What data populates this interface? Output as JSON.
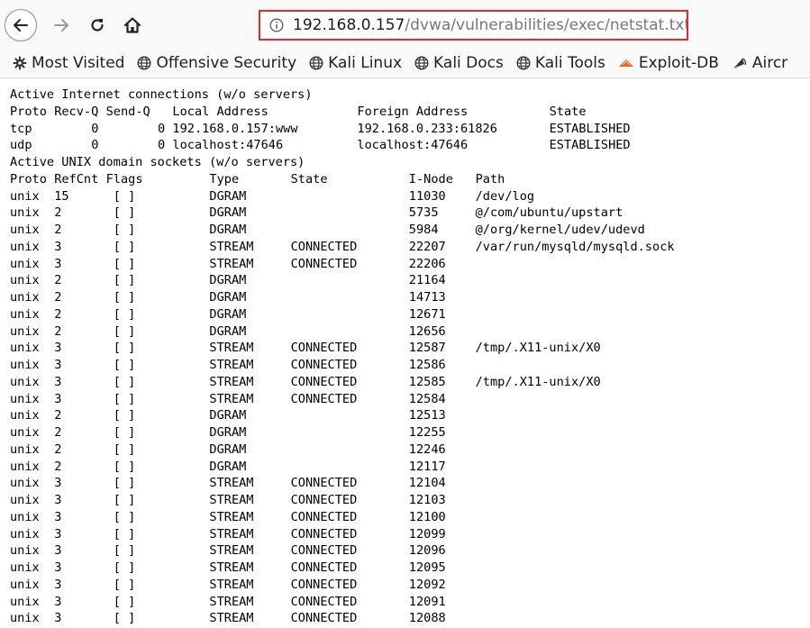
{
  "browser": {
    "url_host": "192.168.0.157",
    "url_path": "/dvwa/vulnerabilities/exec/netstat.txt",
    "icons": {
      "back": "back-arrow-icon",
      "forward": "forward-arrow-icon",
      "reload": "reload-icon",
      "home": "home-icon",
      "info": "info-icon"
    }
  },
  "bookmarks": [
    {
      "label": "Most Visited",
      "icon": "gear-icon"
    },
    {
      "label": "Offensive Security",
      "icon": "globe-icon"
    },
    {
      "label": "Kali Linux",
      "icon": "globe-icon"
    },
    {
      "label": "Kali Docs",
      "icon": "globe-icon"
    },
    {
      "label": "Kali Tools",
      "icon": "globe-icon"
    },
    {
      "label": "Exploit-DB",
      "icon": "exploit-db-icon"
    },
    {
      "label": "Aircr",
      "icon": "aircrack-icon"
    }
  ],
  "netstat": {
    "inet_heading": "Active Internet connections (w/o servers)",
    "inet_columns": [
      "Proto",
      "Recv-Q",
      "Send-Q",
      "Local Address",
      "Foreign Address",
      "State"
    ],
    "inet_rows": [
      [
        "tcp",
        "0",
        "0",
        "192.168.0.157:www",
        "192.168.0.233:61826",
        "ESTABLISHED"
      ],
      [
        "udp",
        "0",
        "0",
        "localhost:47646",
        "localhost:47646",
        "ESTABLISHED"
      ]
    ],
    "unix_heading": "Active UNIX domain sockets (w/o servers)",
    "unix_columns": [
      "Proto",
      "RefCnt",
      "Flags",
      "Type",
      "State",
      "I-Node",
      "Path"
    ],
    "unix_rows": [
      [
        "unix",
        "15",
        "[ ]",
        "DGRAM",
        "",
        "11030",
        "/dev/log"
      ],
      [
        "unix",
        "2",
        "[ ]",
        "DGRAM",
        "",
        "5735",
        "@/com/ubuntu/upstart"
      ],
      [
        "unix",
        "2",
        "[ ]",
        "DGRAM",
        "",
        "5984",
        "@/org/kernel/udev/udevd"
      ],
      [
        "unix",
        "3",
        "[ ]",
        "STREAM",
        "CONNECTED",
        "22207",
        "/var/run/mysqld/mysqld.sock"
      ],
      [
        "unix",
        "3",
        "[ ]",
        "STREAM",
        "CONNECTED",
        "22206",
        ""
      ],
      [
        "unix",
        "2",
        "[ ]",
        "DGRAM",
        "",
        "21164",
        ""
      ],
      [
        "unix",
        "2",
        "[ ]",
        "DGRAM",
        "",
        "14713",
        ""
      ],
      [
        "unix",
        "2",
        "[ ]",
        "DGRAM",
        "",
        "12671",
        ""
      ],
      [
        "unix",
        "2",
        "[ ]",
        "DGRAM",
        "",
        "12656",
        ""
      ],
      [
        "unix",
        "3",
        "[ ]",
        "STREAM",
        "CONNECTED",
        "12587",
        "/tmp/.X11-unix/X0"
      ],
      [
        "unix",
        "3",
        "[ ]",
        "STREAM",
        "CONNECTED",
        "12586",
        ""
      ],
      [
        "unix",
        "3",
        "[ ]",
        "STREAM",
        "CONNECTED",
        "12585",
        "/tmp/.X11-unix/X0"
      ],
      [
        "unix",
        "3",
        "[ ]",
        "STREAM",
        "CONNECTED",
        "12584",
        ""
      ],
      [
        "unix",
        "2",
        "[ ]",
        "DGRAM",
        "",
        "12513",
        ""
      ],
      [
        "unix",
        "2",
        "[ ]",
        "DGRAM",
        "",
        "12255",
        ""
      ],
      [
        "unix",
        "2",
        "[ ]",
        "DGRAM",
        "",
        "12246",
        ""
      ],
      [
        "unix",
        "2",
        "[ ]",
        "DGRAM",
        "",
        "12117",
        ""
      ],
      [
        "unix",
        "3",
        "[ ]",
        "STREAM",
        "CONNECTED",
        "12104",
        ""
      ],
      [
        "unix",
        "3",
        "[ ]",
        "STREAM",
        "CONNECTED",
        "12103",
        ""
      ],
      [
        "unix",
        "3",
        "[ ]",
        "STREAM",
        "CONNECTED",
        "12100",
        ""
      ],
      [
        "unix",
        "3",
        "[ ]",
        "STREAM",
        "CONNECTED",
        "12099",
        ""
      ],
      [
        "unix",
        "3",
        "[ ]",
        "STREAM",
        "CONNECTED",
        "12096",
        ""
      ],
      [
        "unix",
        "3",
        "[ ]",
        "STREAM",
        "CONNECTED",
        "12095",
        ""
      ],
      [
        "unix",
        "3",
        "[ ]",
        "STREAM",
        "CONNECTED",
        "12092",
        ""
      ],
      [
        "unix",
        "3",
        "[ ]",
        "STREAM",
        "CONNECTED",
        "12091",
        ""
      ],
      [
        "unix",
        "3",
        "[ ]",
        "STREAM",
        "CONNECTED",
        "12088",
        ""
      ]
    ]
  },
  "colors": {
    "url_highlight_border": "#e12a2a",
    "exploit_db_icon": "#e0662a"
  }
}
